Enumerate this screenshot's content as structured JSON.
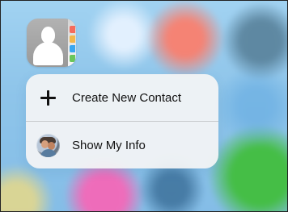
{
  "app_icon": {
    "name": "contacts-app-icon"
  },
  "menu": {
    "items": [
      {
        "label": "Create New Contact",
        "icon": "plus-icon"
      },
      {
        "label": "Show My Info",
        "icon": "avatar-icon"
      }
    ]
  },
  "colors": {
    "menu_background": "#f5f5f5",
    "text": "#111111",
    "blurred_background": "#8fc4ea",
    "green_app_blur": "#45be46",
    "pink_app_blur": "#f468b8",
    "orange_app_blur": "#ff7b67"
  }
}
